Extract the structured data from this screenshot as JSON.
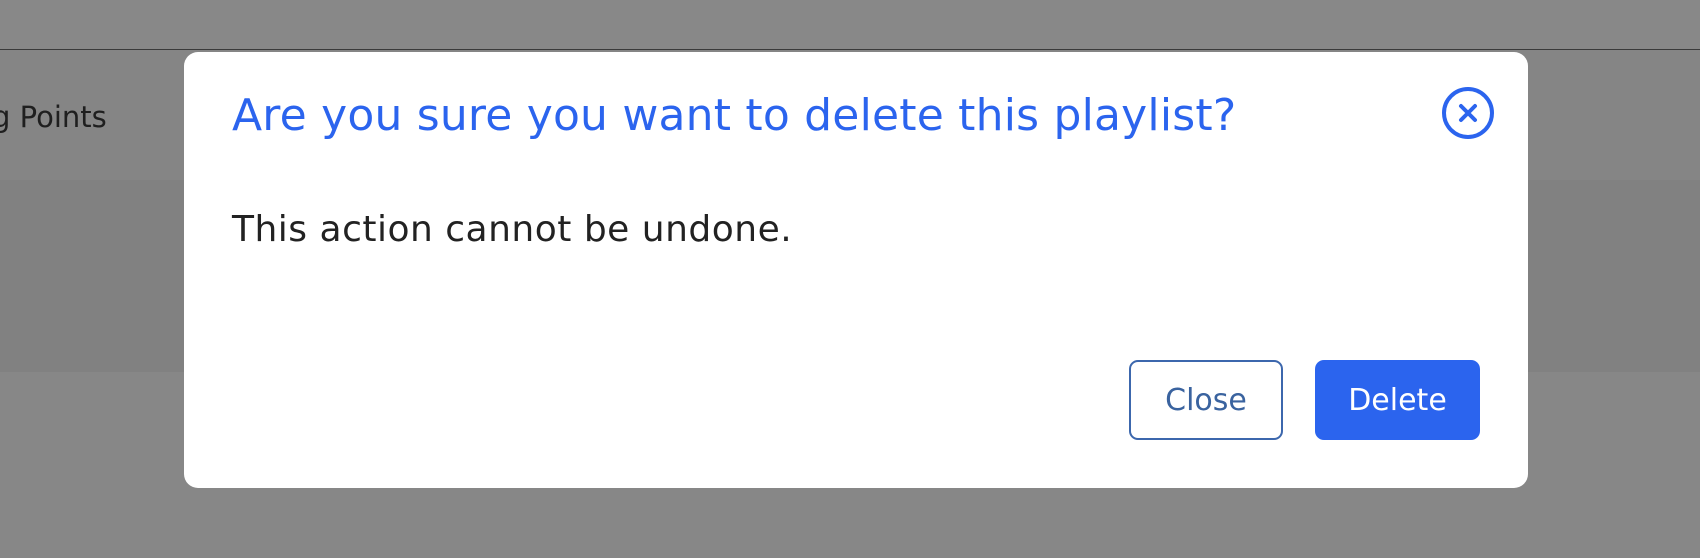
{
  "background": {
    "header_text": "g Points"
  },
  "dialog": {
    "title": "Are you sure you want to delete this playlist?",
    "message": "This action cannot be undone.",
    "close_label": "Close",
    "delete_label": "Delete",
    "close_icon": "close-circle-icon"
  },
  "colors": {
    "accent": "#2b64ee",
    "overlay": "#878787",
    "close_button_border": "#3c67ad",
    "body_text": "#222222"
  }
}
